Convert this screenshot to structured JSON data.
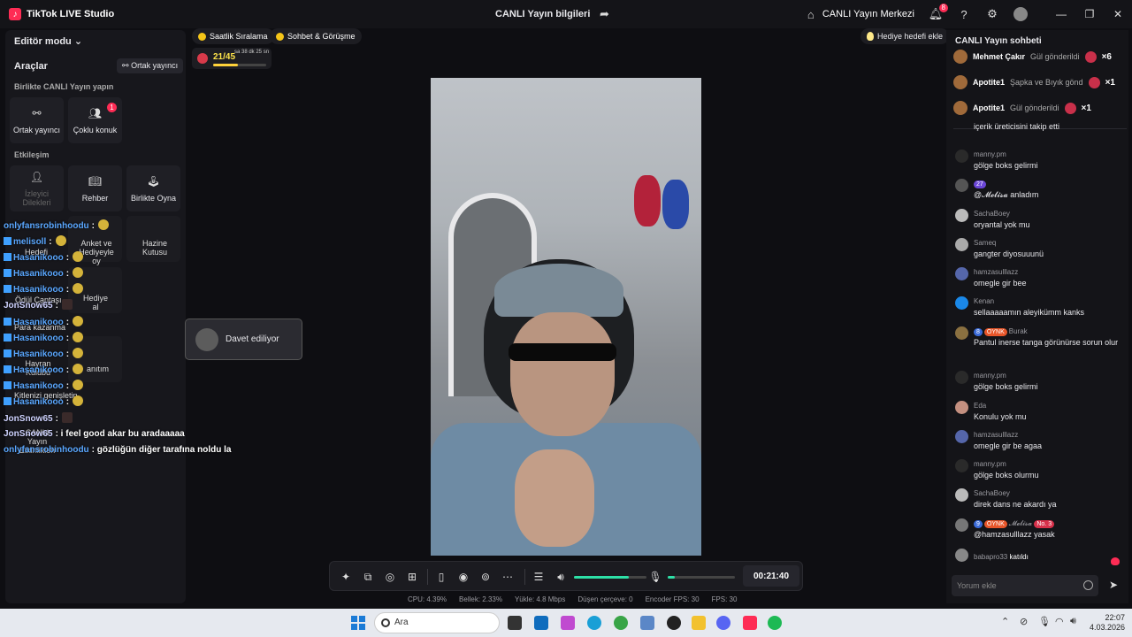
{
  "titlebar": {
    "app_title": "TikTok LIVE Studio",
    "live_info": "CANLI Yayın bilgileri",
    "live_center": "CANLI Yayın Merkezi",
    "notif_count": "8"
  },
  "left": {
    "editor_mode": "Editör modu",
    "tools_title": "Araçlar",
    "cohost_link": "Ortak yayıncı",
    "sec_live_together": "Birlikte CANLI Yayın yapın",
    "sec_interaction": "Etkileşim",
    "tools": {
      "cohost": "Ortak yayıncı",
      "multi_guest": "Çoklu konuk",
      "multi_guest_badge": "1",
      "viewer_likes": "İzleyici Dilekleri",
      "guide": "Rehber",
      "play_together": "Birlikte Oyna"
    },
    "faded_tools": {
      "goal": "Hedefi",
      "survey": "Anket ve Hediyeyle oy",
      "treasure": "Hazine Kutusu",
      "reward_bag": "Ödül Çantası",
      "gift": "Hediye al",
      "money": "Para kazanma",
      "fan": "Hayran Kulübü",
      "promo": "anıtım",
      "audience": "Kitlenizi genişletin",
      "events": "CANLI Yayın Etkinlikleri"
    }
  },
  "overlay_chat": [
    {
      "name": "onlyfansrobinhoodu",
      "text": ":"
    },
    {
      "name": "melisoll",
      "text": ":"
    },
    {
      "name": "Hasanikooo",
      "text": ":"
    },
    {
      "name": "Hasanikooo",
      "text": ":"
    },
    {
      "name": "Hasanikooo",
      "text": ":"
    },
    {
      "name": "JonSnow65",
      "text": ":"
    },
    {
      "name": "Hasanikooo",
      "text": ":"
    },
    {
      "name": "Hasanikooo",
      "text": ":"
    },
    {
      "name": "Hasanikooo",
      "text": ":"
    },
    {
      "name": "Hasanikooo",
      "text": ":"
    },
    {
      "name": "Hasanikooo",
      "text": ":"
    },
    {
      "name": "Hasanikooo",
      "text": ":"
    },
    {
      "name": "JonSnow65",
      "text": ":"
    },
    {
      "name": "JonSnow65",
      "text": ": i feel good akar bu aradaaaaa"
    },
    {
      "name": "onlyfansrobinhoodu",
      "text": ": gözlüğün diğer tarafına noldu la"
    }
  ],
  "top_chips": {
    "hourly_rank": "Saatlik Sıralama",
    "chat_meet": "Sohbet & Görüşme",
    "gift_goal": "Hediye hedefi ekle"
  },
  "goal": {
    "count": "21/45",
    "timer": "sa 38 dk 25 sn",
    "progress": 0.47
  },
  "invite": {
    "text": "Davet ediliyor"
  },
  "controls": {
    "time": "00:21:40",
    "volume": 0.75,
    "mic": 0.1
  },
  "stats": [
    "CPU: 4.39%",
    "Bellek: 2.33%",
    "Yükle: 4.8 Mbps",
    "Düşen çerçeve: 0",
    "Encoder FPS: 30",
    "FPS: 30"
  ],
  "chat": {
    "title": "CANLI Yayın sohbeti",
    "gifts": [
      {
        "user": "Mehmet Çakır",
        "action": "Gül gönderildi",
        "count": "×6"
      },
      {
        "user": "Apotite1",
        "action": "Şapka ve Bıyık gönd",
        "count": "×1"
      },
      {
        "user": "Apotite1",
        "action": "Gül gönderildi",
        "count": "×1"
      }
    ],
    "messages": [
      {
        "user": "",
        "text": "içerik üreticisini takip etti"
      },
      {
        "user": "manny.pm",
        "text": "gölge boks gelirmi"
      },
      {
        "user": "𝓜𝓮𝓵𝓲𝓼𝓪 anladım",
        "text": "@𝓜𝓮𝓵𝓲𝓼𝓪 anladım",
        "badge": "27"
      },
      {
        "user": "SachaBoey",
        "text": "oryantal yok mu"
      },
      {
        "user": "Sameq",
        "text": "gangter diyosuuunü"
      },
      {
        "user": "hamzasulllazz",
        "text": "omegle gir bee"
      },
      {
        "user": "Kenan",
        "text": "sellaaaaamın aleyikümm kanks"
      },
      {
        "user": "Burak",
        "text": "Pantul inerse tanga görünürse sorun olur",
        "badge": "8",
        "badge2": "OYNK"
      },
      {
        "user": "manny.pm",
        "text": "gölge boks gelirmi"
      },
      {
        "user": "Eda",
        "text": "Konulu yok mu"
      },
      {
        "user": "hamzasulllazz",
        "text": "omegle gir be agaa"
      },
      {
        "user": "manny.pm",
        "text": "gölge boks olurmu"
      },
      {
        "user": "SachaBoey",
        "text": "direk dans ne akardı ya"
      },
      {
        "user": "𝓜𝓮𝓵𝓲𝓼𝓪",
        "text": "@hamzasulllazz yasak",
        "badge": "9",
        "badge2": "OYNK",
        "badge3": "No. 3"
      },
      {
        "user": "babapro33",
        "text": "katıldı"
      }
    ],
    "comment_placeholder": "Yorum ekle"
  },
  "taskbar": {
    "search": "Ara",
    "time": "22:07",
    "date": "4.03.2026"
  }
}
